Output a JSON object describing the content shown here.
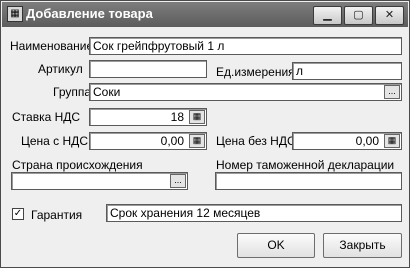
{
  "window": {
    "title": "Добавление товара",
    "controls": {
      "minimize": "▁",
      "maximize": "▢",
      "close": "✕"
    }
  },
  "form": {
    "name": {
      "label": "Наименование",
      "value": "Сок грейпфрутовый 1 л"
    },
    "article": {
      "label": "Артикул",
      "value": ""
    },
    "unit": {
      "label": "Ед.измерения",
      "value": "л"
    },
    "group": {
      "label": "Группа",
      "value": "Соки",
      "button": "..."
    },
    "vat": {
      "label": "Ставка НДС",
      "value": "18"
    },
    "price_with_vat": {
      "label": "Цена с НДС",
      "value": "0,00"
    },
    "price_without_vat": {
      "label": "Цена без НДС",
      "value": "0,00"
    },
    "country": {
      "label": "Страна происхождения",
      "value": "",
      "button": "..."
    },
    "customs": {
      "label": "Номер таможенной декларации",
      "value": ""
    },
    "warranty": {
      "label": "Гарантия",
      "checked": true,
      "check_mark": "✓",
      "value": "Срок хранения 12 месяцев"
    }
  },
  "buttons": {
    "ok": "OK",
    "cancel": "Закрыть"
  },
  "icons": {
    "calc": "calculator-icon",
    "ellipsis": "ellipsis-icon"
  }
}
